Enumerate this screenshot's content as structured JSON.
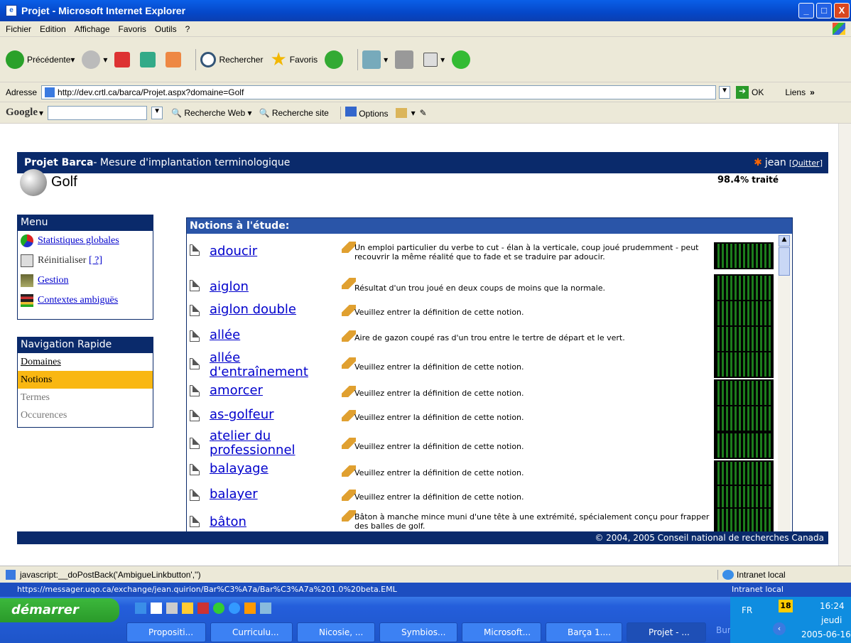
{
  "window": {
    "title": "Projet - Microsoft Internet Explorer",
    "min": "_",
    "max": "□",
    "close": "X"
  },
  "menubar": [
    "Fichier",
    "Edition",
    "Affichage",
    "Favoris",
    "Outils",
    "?"
  ],
  "toolbar": {
    "back_label": "Précédente",
    "search_label": "Rechercher",
    "favorites_label": "Favoris"
  },
  "address": {
    "label": "Adresse",
    "url": "http://dev.crtl.ca/barca/Projet.aspx?domaine=Golf",
    "go_label": "OK",
    "links_label": "Liens"
  },
  "googlebar": {
    "logo": "Google",
    "web_search": "Recherche Web",
    "site_search": "Recherche site",
    "options": "Options"
  },
  "page": {
    "app_title": "Projet Barca",
    "app_subtitle": " - Mesure d'implantation terminologique",
    "user": "jean",
    "quit": "[Quitter]",
    "domain": "Golf",
    "progress_text": "98.4",
    "progress_suffix": "% traité",
    "menu": {
      "title": "Menu",
      "items": [
        "Statistiques globales",
        "Réinitialiser",
        "[ ?]",
        "Gestion",
        "Contextes ambiguës"
      ]
    },
    "nav": {
      "title": "Navigation Rapide",
      "items": [
        "Domaines",
        "Notions",
        "Termes",
        "Occurences"
      ],
      "active": "Notions"
    },
    "notions_title": "Notions à l'étude:",
    "notions": [
      {
        "name": "adoucir",
        "def": "Un emploi particulier du verbe to cut - élan à la verticale, coup joué prudemment - peut recouvrir la même réalité que to fade et se traduire par adoucir."
      },
      {
        "name": "aiglon",
        "def": "Résultat d'un trou joué en deux coups de moins que la normale."
      },
      {
        "name": "aiglon double",
        "def": "Veuillez entrer la définition de cette notion."
      },
      {
        "name": "allée",
        "def": "Aire de gazon coupé ras d'un trou entre le tertre de départ et le vert."
      },
      {
        "name": "allée d'entraînement",
        "def": "Veuillez entrer la définition de cette notion."
      },
      {
        "name": "amorcer",
        "def": "Veuillez entrer la définition de cette notion."
      },
      {
        "name": "as-golfeur",
        "def": "Veuillez entrer la définition de cette notion."
      },
      {
        "name": "atelier du professionnel",
        "def": "Veuillez entrer la définition de cette notion."
      },
      {
        "name": "balayage",
        "def": "Veuillez entrer la définition de cette notion."
      },
      {
        "name": "balayer",
        "def": "Veuillez entrer la définition de cette notion."
      },
      {
        "name": "bâton",
        "def": "Bâton à manche mince muni d'une tête à une extrémité, spécialement conçu pour frapper des balles de golf."
      }
    ],
    "footer": "© 2004, 2005 Conseil national de recherches Canada"
  },
  "status": {
    "text": "javascript:__doPostBack('AmbigueLinkbutton','')",
    "zone": "Intranet local",
    "secondary": "https://messager.uqo.ca/exchange/jean.quirion/Bar%C3%A7a/Bar%C3%A7a%201.0%20beta.EML",
    "secondary_zone": "Intranet local"
  },
  "taskbar": {
    "start": "démarrer",
    "buttons": [
      "Propositi...",
      "Curriculu...",
      "Nicosie, ...",
      "Symbios...",
      "Microsoft...",
      "Barça 1....",
      "Projet - ..."
    ],
    "bureau": "Bureau",
    "lang": "FR",
    "time": "16:24",
    "day": "jeudi",
    "date": "2005-06-16",
    "cal": "18"
  },
  "colors": {
    "header": "#0a2a6b",
    "nav_active": "#f9b712",
    "link": "#0000cc"
  }
}
